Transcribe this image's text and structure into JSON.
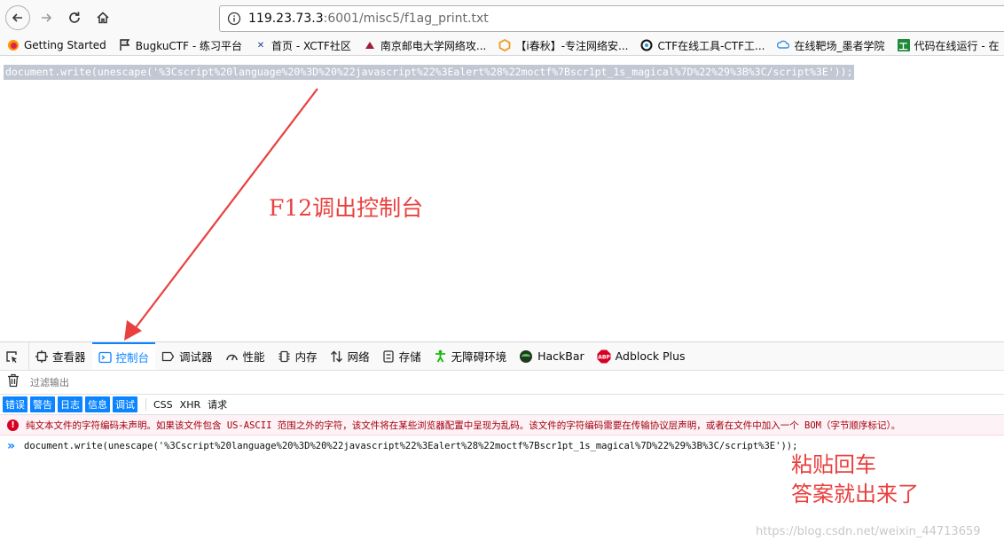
{
  "browser": {
    "url_host": "119.23.73.3",
    "url_rest": ":6001/misc5/f1ag_print.txt",
    "bookmarks": [
      {
        "label": "Getting Started",
        "icon": "firefox-icon"
      },
      {
        "label": "BugkuCTF - 练习平台",
        "icon": "flag-icon"
      },
      {
        "label": "首页 - XCTF社区",
        "icon": "xctf-icon"
      },
      {
        "label": "南京邮电大学网络攻...",
        "icon": "njupt-icon"
      },
      {
        "label": "【i春秋】-专注网络安...",
        "icon": "ichunqiu-icon"
      },
      {
        "label": "CTF在线工具-CTF工...",
        "icon": "ctf-tools-icon"
      },
      {
        "label": "在线靶场_墨者学院",
        "icon": "mozhe-icon"
      },
      {
        "label": "代码在线运行 - 在",
        "icon": "code-icon"
      }
    ]
  },
  "page": {
    "code": "document.write(unescape('%3Cscript%20language%20%3D%20%22javascript%22%3Ealert%28%22moctf%7Bscr1pt_1s_magical%7D%22%29%3B%3C/script%3E'));"
  },
  "annotations": {
    "top": "F12调出控制台",
    "bottom_line1": "粘贴回车",
    "bottom_line2": "答案就出来了"
  },
  "devtools": {
    "tabs": [
      {
        "label": "查看器",
        "icon": "inspector-icon"
      },
      {
        "label": "控制台",
        "icon": "console-icon",
        "active": true
      },
      {
        "label": "调试器",
        "icon": "debugger-icon"
      },
      {
        "label": "性能",
        "icon": "performance-icon"
      },
      {
        "label": "内存",
        "icon": "memory-icon"
      },
      {
        "label": "网络",
        "icon": "network-icon"
      },
      {
        "label": "存储",
        "icon": "storage-icon"
      },
      {
        "label": "无障碍环境",
        "icon": "accessibility-icon"
      },
      {
        "label": "HackBar",
        "icon": "hackbar-icon"
      },
      {
        "label": "Adblock Plus",
        "icon": "adblock-icon"
      }
    ],
    "filter_placeholder": "过滤输出",
    "levels": [
      "错误",
      "警告",
      "日志",
      "信息",
      "调试"
    ],
    "extra_filters": [
      "CSS",
      "XHR",
      "请求"
    ],
    "error_message": "纯文本文件的字符编码未声明。如果该文件包含 US-ASCII 范围之外的字符，该文件将在某些浏览器配置中呈现为乱码。该文件的字符编码需要在传输协议层声明，或者在文件中加入一个 BOM（字节顺序标记）。",
    "input": "document.write(unescape('%3Cscript%20language%20%3D%20%22javascript%22%3Ealert%28%22moctf%7Bscr1pt_1s_magical%7D%22%29%3B%3C/script%3E'));"
  },
  "watermark": "https://blog.csdn.net/weixin_44713659",
  "colors": {
    "accent": "#0a84ff",
    "annotation": "#e8403e",
    "error": "#d70022"
  }
}
